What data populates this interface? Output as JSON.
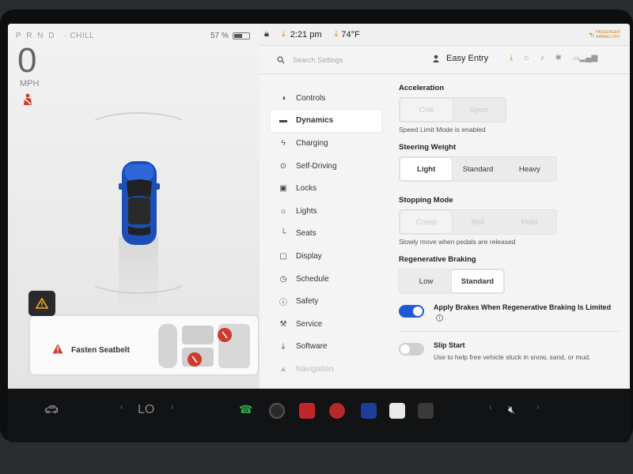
{
  "status": {
    "gears": "P R N D",
    "drive_mode": "CHILL",
    "battery_percent": "57 %",
    "battery_level": 0.57,
    "speed": "0",
    "speed_unit": "MPH",
    "time": "2:21 pm",
    "temperature": "74°F",
    "airbag_label": "PASSENGER AIRBAG OFF"
  },
  "alert": {
    "seatbelt_label": "Fasten Seatbelt"
  },
  "header": {
    "search_placeholder": "Search Settings",
    "profile": "Easy Entry",
    "signal_label": "LTE"
  },
  "nav": {
    "items": [
      {
        "label": "Controls",
        "icon": "toggle-icon"
      },
      {
        "label": "Dynamics",
        "icon": "car-icon",
        "active": true
      },
      {
        "label": "Charging",
        "icon": "bolt-icon"
      },
      {
        "label": "Self-Driving",
        "icon": "steering-wheel-icon"
      },
      {
        "label": "Locks",
        "icon": "lock-icon"
      },
      {
        "label": "Lights",
        "icon": "sun-icon"
      },
      {
        "label": "Seats",
        "icon": "seat-icon"
      },
      {
        "label": "Display",
        "icon": "display-icon"
      },
      {
        "label": "Schedule",
        "icon": "clock-icon"
      },
      {
        "label": "Safety",
        "icon": "info-icon"
      },
      {
        "label": "Service",
        "icon": "wrench-icon"
      },
      {
        "label": "Software",
        "icon": "download-icon"
      },
      {
        "label": "Navigation",
        "icon": "navigation-icon"
      }
    ]
  },
  "dynamics": {
    "acceleration": {
      "title": "Acceleration",
      "options": [
        "Chill",
        "Sport"
      ],
      "selected": "Chill",
      "hint": "Speed Limit Mode is enabled"
    },
    "steering": {
      "title": "Steering Weight",
      "options": [
        "Light",
        "Standard",
        "Heavy"
      ],
      "selected": "Light"
    },
    "stopping": {
      "title": "Stopping Mode",
      "options": [
        "Creep",
        "Roll",
        "Hold"
      ],
      "selected": "Creep",
      "hint": "Slowly move when pedals are released"
    },
    "regen": {
      "title": "Regenerative Braking",
      "options": [
        "Low",
        "Standard"
      ],
      "selected": "Standard"
    },
    "apply_brakes": {
      "label": "Apply Brakes When Regenerative Braking Is Limited",
      "on": true
    },
    "slip_start": {
      "label": "Slip Start",
      "description": "Use to help free vehicle stuck in snow, sand, or mud.",
      "on": false
    }
  },
  "dock": {
    "climate_label": "LO"
  },
  "colors": {
    "accent": "#1f5ad6",
    "alert_red": "#d03a2c",
    "download_orange": "#e38b1a"
  }
}
